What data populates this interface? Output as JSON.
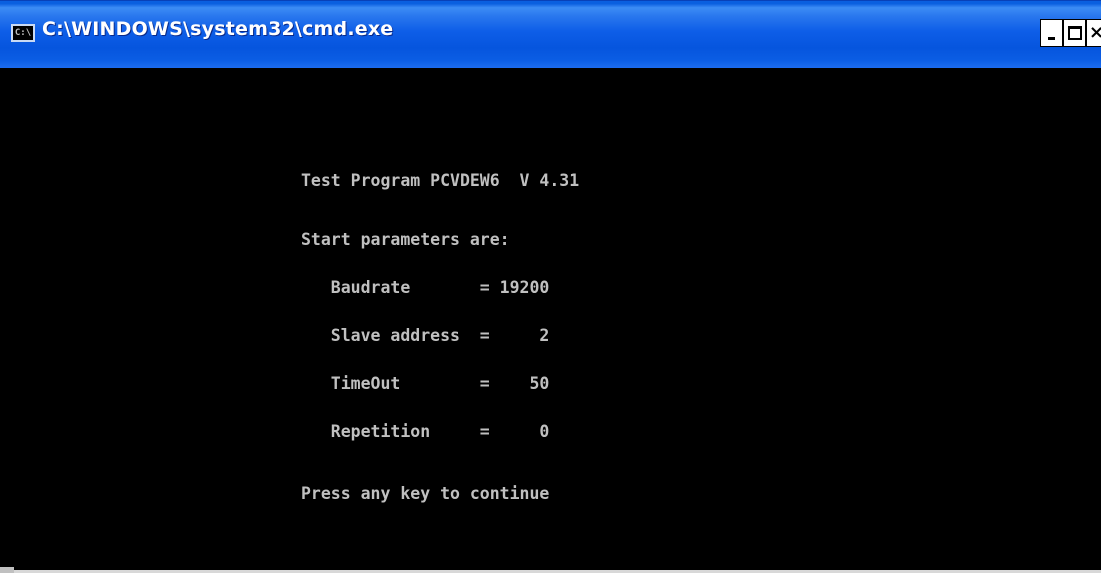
{
  "window": {
    "title": "C:\\WINDOWS\\system32\\cmd.exe",
    "icon_label": "C:\\",
    "controls": {
      "minimize": "minimize",
      "maximize": "maximize",
      "close": "×"
    }
  },
  "console": {
    "lines": [
      "Test Program PCVDEW6  V 4.31",
      "Start parameters are:",
      "   Baudrate       = 19200",
      "   Slave address  =     2",
      "   TimeOut        =    50",
      "   Repetition     =     0",
      "Press any key to continue"
    ]
  },
  "colors": {
    "titlebar": "#0a5fe0",
    "console_bg": "#000000",
    "console_text": "#c0c0c0"
  }
}
